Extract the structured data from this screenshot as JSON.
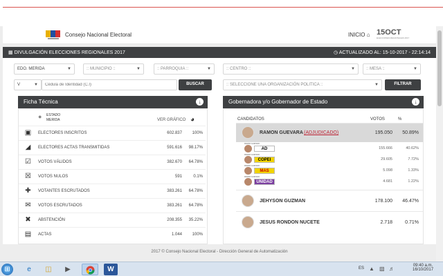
{
  "header": {
    "org_name": "Consejo Nacional Electoral",
    "nav_inicio": "INICIO",
    "oct_logo": "15OCT",
    "oct_sub": "ELECCIONES REGIONALES 2017"
  },
  "titlebar": {
    "left": "DIVULGACIÓN ELECCIONES REGIONALES 2017",
    "right": "ACTUALIZADO AL: 15-10-2017 - 22:14:14"
  },
  "filters": {
    "estado": "EDO. MERIDA",
    "municipio": ":: MUNICIPIO ::",
    "parroquia": ":: PARROQUIA ::",
    "centro": ":: CENTRO ::",
    "mesa": ":: MESA ::",
    "nacionalidad": "V",
    "cedula_placeholder": "Cédula de Identidad (C.I)",
    "buscar": "BUSCAR",
    "organizacion": ":: SELECCIONE UNA ORGANIZACIÓN POLITICA ::",
    "filtrar": "FILTRAR"
  },
  "ficha": {
    "title": "Ficha Técnica",
    "estado_label": "ESTADO",
    "estado_value": "MERIDA",
    "ver_grafico": "VER GRÁFICO",
    "rows": [
      {
        "icon": "user-icon",
        "label": "ELECTORES INSCRITOS",
        "value": "602.837",
        "pct": "100%"
      },
      {
        "icon": "rss-icon",
        "label": "ELECTORES ACTAS TRANSMITIDAS",
        "value": "591.616",
        "pct": "98.17%"
      },
      {
        "icon": "check-icon",
        "label": "VOTOS VÁLIDOS",
        "value": "382.670",
        "pct": "64.78%"
      },
      {
        "icon": "x-icon",
        "label": "VOTOS NULOS",
        "value": "591",
        "pct": "0.1%"
      },
      {
        "icon": "user-plus-icon",
        "label": "VOTANTES ESCRUTADOS",
        "value": "383.261",
        "pct": "64.78%"
      },
      {
        "icon": "envelope-icon",
        "label": "VOTOS ESCRUTADOS",
        "value": "383.261",
        "pct": "64.78%"
      },
      {
        "icon": "user-x-icon",
        "label": "ABSTENCIÓN",
        "value": "208.355",
        "pct": "35.22%"
      },
      {
        "icon": "document-icon",
        "label": "ACTAS",
        "value": "1.044",
        "pct": "100%"
      }
    ]
  },
  "gobernador": {
    "title": "Gobernadora y/o Gobernador de Estado",
    "col_candidatos": "CANDIDATOS",
    "col_votos": "VOTOS",
    "col_pct": "%",
    "winner": {
      "name": "RAMON GUEVARA",
      "tag": "(ADJUDICADO)",
      "votes": "195.050",
      "pct": "50.89%"
    },
    "subs": [
      {
        "logo": "AD",
        "color": "#ffffff",
        "fg": "#000",
        "votes": "155.666",
        "pct": "40.62%",
        "tag": "RAMON GUEVARA"
      },
      {
        "logo": "COPEI",
        "color": "#f2d400",
        "fg": "#000",
        "votes": "29.605",
        "pct": "7.72%",
        "tag": "RAMON GUEVARA"
      },
      {
        "logo": "MAS",
        "color": "#f2d400",
        "fg": "#c00",
        "votes": "5.098",
        "pct": "1.33%",
        "tag": "RAMON GUEVARA"
      },
      {
        "logo": "UNIDAD",
        "color": "#7b3fa0",
        "fg": "#fff",
        "votes": "4.681",
        "pct": "1.22%",
        "tag": "RAMON GUEVARA"
      }
    ],
    "others": [
      {
        "name": "JEHYSON GUZMAN",
        "votes": "178.100",
        "pct": "46.47%"
      },
      {
        "name": "JESUS RONDON NUCETE",
        "votes": "2.718",
        "pct": "0.71%"
      }
    ]
  },
  "footer": "2017 © Consejo Nacional Electoral - Dirección General de Automatización",
  "taskbar": {
    "lang": "ES",
    "time": "09:40 a.m.",
    "date": "16/10/2017"
  }
}
